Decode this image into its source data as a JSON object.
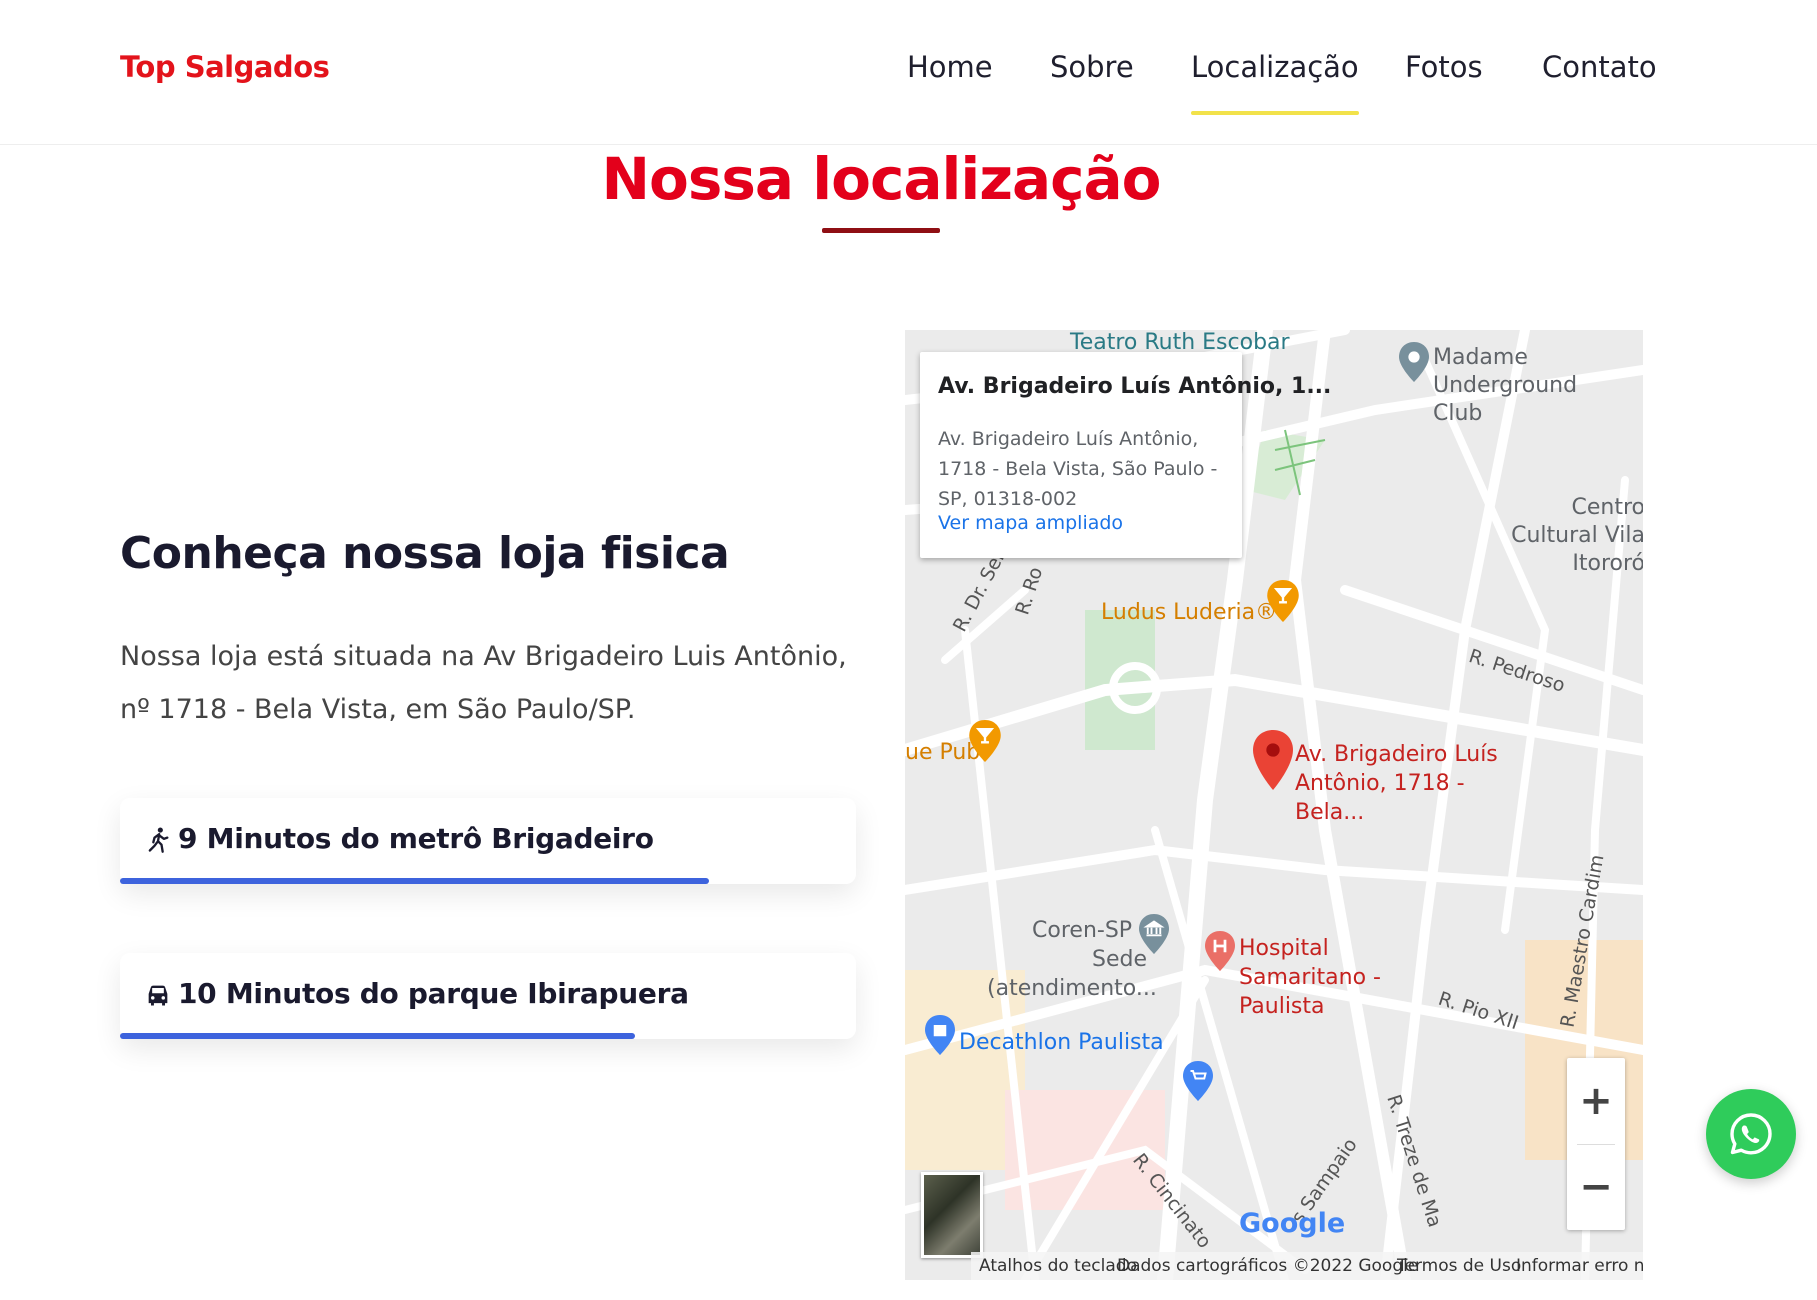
{
  "header": {
    "brand": "Top Salgados",
    "nav": [
      {
        "label": "Home",
        "active": false
      },
      {
        "label": "Sobre",
        "active": false
      },
      {
        "label": "Localização",
        "active": true
      },
      {
        "label": "Fotos",
        "active": false
      },
      {
        "label": "Contato",
        "active": false
      }
    ]
  },
  "section": {
    "title": "Nossa localização"
  },
  "store": {
    "heading": "Conheça nossa loja fisica",
    "text": "Nossa loja está situada na Av Brigadeiro Luis Antônio, nº 1718 - Bela Vista, em São Paulo/SP.",
    "cards": [
      {
        "icon": "walking-icon",
        "label": "9 Minutos do metrô Brigadeiro",
        "progress": 0.8
      },
      {
        "icon": "car-icon",
        "label": "10 Minutos do parque Ibirapuera",
        "progress": 0.7
      }
    ]
  },
  "map": {
    "info_window": {
      "title": "Av. Brigadeiro Luís Antônio, 1...",
      "address": "Av. Brigadeiro Luís Antônio, 1718 - Bela Vista, São Paulo - SP, 01318-002",
      "link": "Ver mapa ampliado"
    },
    "places": {
      "teatro": "Teatro Ruth Escobar",
      "madame": "Madame Underground Club",
      "centro": "Centro Cultural Vila Itororó",
      "ludus": "Ludus Luderia®",
      "pub": "ue Pub",
      "marker": "Av. Brigadeiro Luís Antônio, 1718 - Bela...",
      "coren": "Coren-SP - Sede (atendimento...",
      "hospital": "Hospital Samaritano - Paulista",
      "decathlon": "Decathlon Paulista"
    },
    "streets": {
      "dr_ser": "R. Dr. Ser",
      "ro": "R. Ro",
      "pedroso": "R. Pedroso",
      "pio": "R. Pio XII",
      "maestro": "R. Maestro Cardim",
      "treze": "R. Treze de Ma",
      "cincinato": "R. Cincinato",
      "sampaio": "s Sampaio"
    },
    "google": "Google",
    "zoom_in": "+",
    "zoom_out": "−",
    "attribution": {
      "shortcuts": "Atalhos do teclado",
      "data": "Dados cartográficos ©2022 Google",
      "terms": "Termos de Uso",
      "report": "Informar erro no mapa"
    }
  },
  "colors": {
    "brand_red": "#e3131b",
    "underline_dark_red": "#8f0f14",
    "nav_active": "#f2e24a",
    "progress_blue": "#3d63dd",
    "whatsapp_green": "#2fcc5b"
  },
  "icons": {
    "whatsapp": "whatsapp-icon"
  }
}
